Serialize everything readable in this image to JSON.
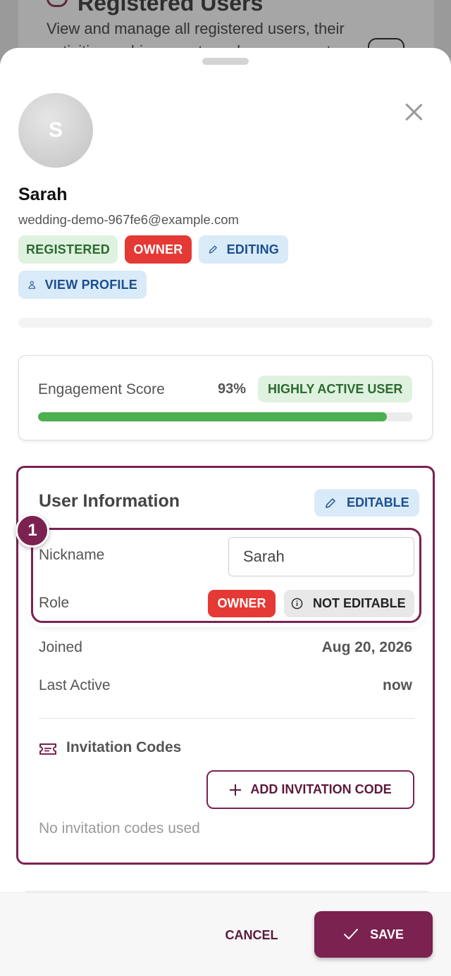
{
  "background": {
    "title": "Registered Users",
    "description_line1": "View and manage all registered users, their",
    "description_line2": "activities, achievements and engagement"
  },
  "user": {
    "avatar_initial": "S",
    "name": "Sarah",
    "email": "wedding-demo-967fe6@example.com",
    "chips": {
      "registered": "REGISTERED",
      "owner": "OWNER",
      "editing": "EDITING",
      "view_profile": "VIEW PROFILE"
    }
  },
  "engagement": {
    "label": "Engagement Score",
    "percent_text": "93%",
    "percent": 93,
    "badge": "HIGHLY ACTIVE USER"
  },
  "user_information": {
    "title": "User Information",
    "editable_chip": "EDITABLE",
    "step_number": "1",
    "nickname_label": "Nickname",
    "nickname_value": "Sarah",
    "role_label": "Role",
    "role_value": "OWNER",
    "role_locked": "NOT EDITABLE",
    "joined_label": "Joined",
    "joined_value": "Aug 20, 2026",
    "last_active_label": "Last Active",
    "last_active_value": "now",
    "invitation_title": "Invitation Codes",
    "add_invitation_label": "ADD INVITATION CODE",
    "no_invitation_text": "No invitation codes used"
  },
  "footer": {
    "cancel_label": "CANCEL",
    "save_label": "SAVE"
  },
  "colors": {
    "brand": "#7b2250",
    "success": "#4caf50",
    "danger": "#e53935",
    "info_bg": "#d9eaf8"
  }
}
